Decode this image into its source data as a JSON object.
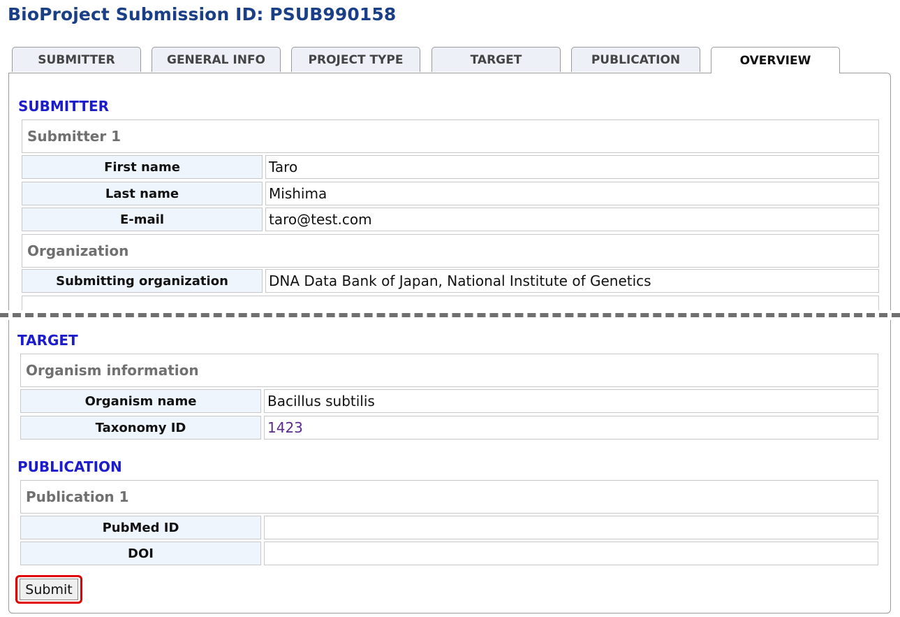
{
  "page": {
    "title": "BioProject Submission ID: PSUB990158"
  },
  "tabs": [
    {
      "label": "SUBMITTER"
    },
    {
      "label": "GENERAL INFO"
    },
    {
      "label": "PROJECT TYPE"
    },
    {
      "label": "TARGET"
    },
    {
      "label": "PUBLICATION"
    },
    {
      "label": "OVERVIEW",
      "active": true
    }
  ],
  "submitter": {
    "section_title": "SUBMITTER",
    "group_title": "Submitter 1",
    "rows": [
      {
        "label": "First name",
        "value": "Taro"
      },
      {
        "label": "Last name",
        "value": "Mishima"
      },
      {
        "label": "E-mail",
        "value": "taro@test.com"
      }
    ],
    "organization": {
      "group_title": "Organization",
      "rows": [
        {
          "label": "Submitting organization",
          "value": "DNA Data Bank of Japan, National Institute of Genetics"
        }
      ]
    }
  },
  "target": {
    "section_title": "TARGET",
    "group_title": "Organism information",
    "rows": [
      {
        "label": "Organism name",
        "value": "Bacillus subtilis"
      },
      {
        "label": "Taxonomy ID",
        "value": "1423"
      }
    ]
  },
  "publication": {
    "section_title": "PUBLICATION",
    "group_title": "Publication 1",
    "rows": [
      {
        "label": "PubMed ID",
        "value": ""
      },
      {
        "label": "DOI",
        "value": ""
      }
    ]
  },
  "actions": {
    "submit_label": "Submit"
  },
  "colors": {
    "title": "#1a3f86",
    "section_title": "#1c1ccc",
    "label_bg": "#eef5fd",
    "highlight": "#e00000",
    "link": "#5b2a8a"
  }
}
